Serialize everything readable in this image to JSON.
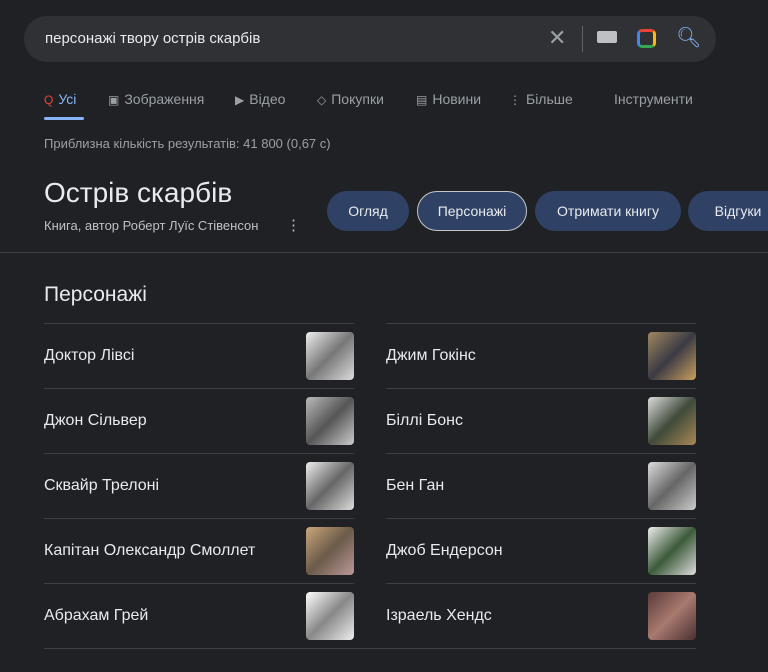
{
  "search": {
    "query": "персонажі твору острів скарбів",
    "icons": [
      "close-icon",
      "keyboard-icon",
      "camera-lens-icon",
      "search-icon"
    ]
  },
  "tabs": [
    {
      "label": "Усі",
      "icon": "google-search-icon",
      "active": true
    },
    {
      "label": "Зображення",
      "icon": "image-icon"
    },
    {
      "label": "Відео",
      "icon": "play-icon"
    },
    {
      "label": "Покупки",
      "icon": "tag-icon"
    },
    {
      "label": "Новини",
      "icon": "news-icon"
    },
    {
      "label": "Більше",
      "icon": "more-vert-icon"
    },
    {
      "label": "Інструменти"
    }
  ],
  "result_count": "Приблизна кількість результатів: 41 800 (0,67 с)",
  "entity": {
    "title": "Острів скарбів",
    "subtitle": "Книга, автор Роберт Луїс Стівенсон",
    "more": "⋮"
  },
  "chips": [
    {
      "label": "Огляд"
    },
    {
      "label": "Персонажі",
      "selected": true
    },
    {
      "label": "Отримати книгу"
    },
    {
      "label": "Відгуки"
    }
  ],
  "section_title": "Персонажі",
  "left": [
    "Доктор Лівсі",
    "Джон Сільвер",
    "Сквайр Трелоні",
    "Капітан Олександр Смоллет",
    "Абрахам Грей"
  ],
  "right": [
    "Джим Гокінс",
    "Біллі Бонс",
    "Бен Ган",
    "Джоб Ендерсон",
    "Ізраель Хендс"
  ],
  "colors": {
    "background": "#202124",
    "chip": "#2f4266",
    "accent": "#8ab4f8"
  }
}
